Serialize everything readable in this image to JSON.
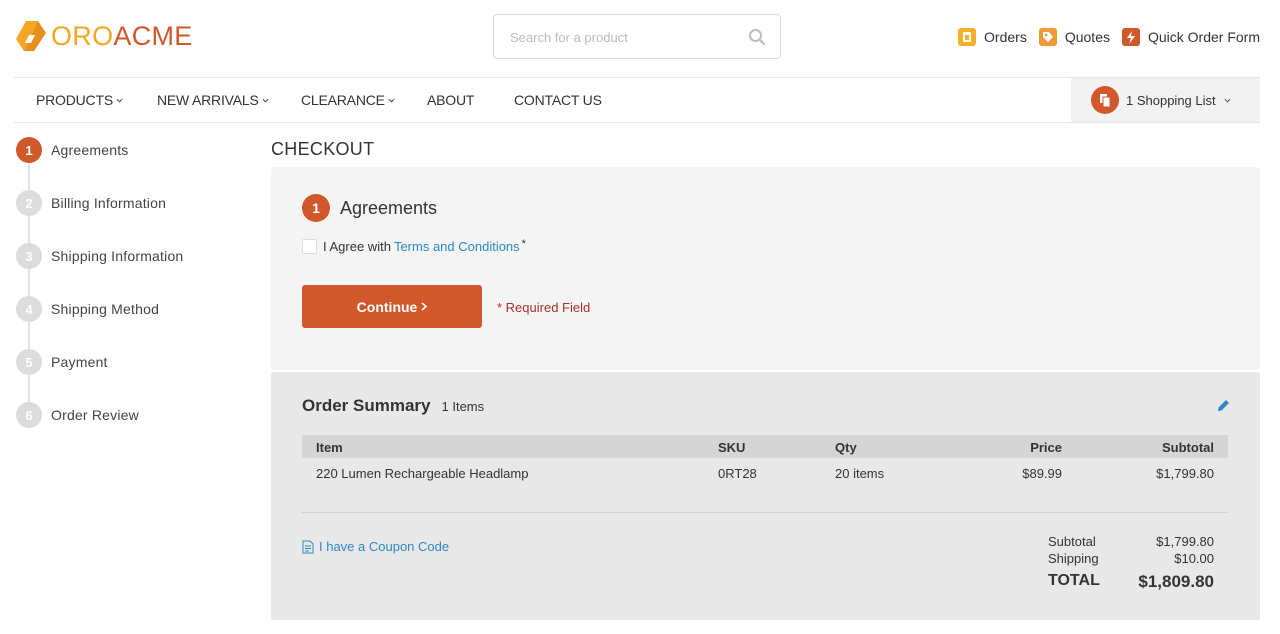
{
  "brand": {
    "name_part1": "ORO",
    "name_part2": "ACME",
    "primary_color": "#f5a623",
    "accent_color": "#d0582a"
  },
  "search": {
    "placeholder": "Search for a product"
  },
  "top_links": [
    {
      "label": "Orders",
      "icon": "orders-icon"
    },
    {
      "label": "Quotes",
      "icon": "quotes-icon"
    },
    {
      "label": "Quick Order Form",
      "icon": "quick-order-icon"
    }
  ],
  "nav": {
    "items": [
      {
        "label": "PRODUCTS",
        "has_dropdown": true
      },
      {
        "label": "NEW ARRIVALS",
        "has_dropdown": true
      },
      {
        "label": "CLEARANCE",
        "has_dropdown": true
      },
      {
        "label": "ABOUT",
        "has_dropdown": false
      },
      {
        "label": "CONTACT US",
        "has_dropdown": false
      }
    ],
    "shopping_list": "1 Shopping List"
  },
  "steps": [
    {
      "num": "1",
      "label": "Agreements",
      "active": true
    },
    {
      "num": "2",
      "label": "Billing Information",
      "active": false
    },
    {
      "num": "3",
      "label": "Shipping Information",
      "active": false
    },
    {
      "num": "4",
      "label": "Shipping Method",
      "active": false
    },
    {
      "num": "5",
      "label": "Payment",
      "active": false
    },
    {
      "num": "6",
      "label": "Order Review",
      "active": false
    }
  ],
  "page_title": "CHECKOUT",
  "agreements": {
    "num": "1",
    "title": "Agreements",
    "agree_prefix": "I Agree with",
    "agree_link": "Terms and Conditions",
    "required_marker": "*",
    "continue_label": "Continue",
    "required_note": "* Required Field"
  },
  "summary": {
    "title": "Order Summary",
    "count": "1 Items",
    "columns": {
      "item": "Item",
      "sku": "SKU",
      "qty": "Qty",
      "price": "Price",
      "subtotal": "Subtotal"
    },
    "rows": [
      {
        "item": "220 Lumen Rechargeable Headlamp",
        "sku": "0RT28",
        "qty": "20 items",
        "price": "$89.99",
        "subtotal": "$1,799.80"
      }
    ],
    "coupon_label": "I have a Coupon Code",
    "totals": {
      "subtotal_label": "Subtotal",
      "subtotal": "$1,799.80",
      "shipping_label": "Shipping",
      "shipping": "$10.00",
      "total_label": "TOTAL",
      "total": "$1,809.80"
    }
  }
}
